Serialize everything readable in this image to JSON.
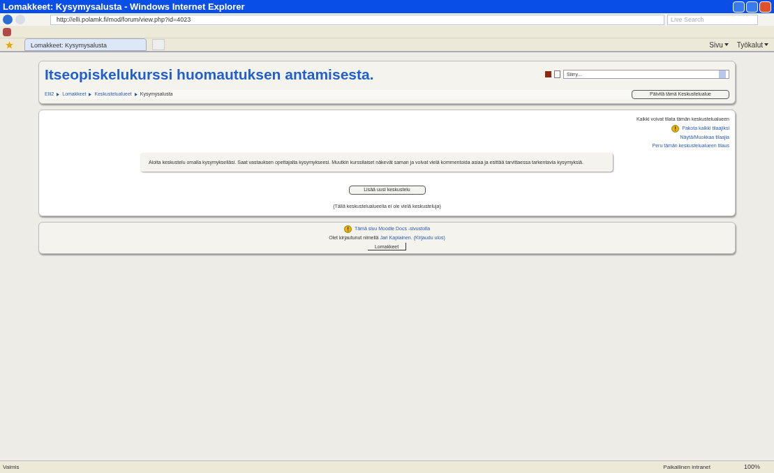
{
  "window": {
    "title": "Lomakkeet: Kysymysalusta - Windows Internet Explorer"
  },
  "address_bar": {
    "url": "http://elli.polamk.fi/mod/forum/view.php?id=4023"
  },
  "search": {
    "placeholder": "Live Search"
  },
  "tabs": [
    {
      "label": "Lomakkeet: Kysymysalusta",
      "selected": true
    }
  ],
  "command_bar": [
    "Sivu",
    "Työkalut"
  ],
  "header": {
    "title": "Itseopiskelukurssi huomautuksen antamisesta.",
    "jump_select": "Siirry...",
    "breadcrumb": [
      "Elli2",
      "Lomakkeet",
      "Keskustelualueet",
      "Kysymysalusta"
    ],
    "update_button": "Päivitä tämä Keskustelualue"
  },
  "subscription": {
    "note": "Kaikki voivat tilata tämän keskustelualueen",
    "links": [
      {
        "label": "Pakota kaikki tilaajiksi",
        "kind": "warning"
      },
      {
        "label": "Näytä/Muokkaa tilaajia",
        "kind": "plain"
      },
      {
        "label": "Peru tämän keskustelualueen tilaus",
        "kind": "plain"
      }
    ]
  },
  "intro": "Aloita keskustelu omalla kysymykselläsi. Saat vastauksen opettajalta kysymykseesi. Muutkin kurssilaiset näkevät saman ja voivat vielä kommentoida asiaa ja esittää tarvittaessa tarkentavia kysymyksiä.",
  "add_button": "Lisää uusi keskustelu",
  "empty_note": "(Tällä keskustelualueella ei ole vielä keskusteluja)",
  "footer": {
    "docs_link": "Tämä sivu Moodle Docs -sivustolla",
    "login_prefix": "Olet kirjautunut nimellä",
    "user_link": "Jari Kapiainen.",
    "logout_link": "(Kirjaudu ulos)",
    "course_button": "Lomakkeet"
  },
  "status_bar": {
    "text": "Valmis",
    "zone": "Paikallinen intranet",
    "zoom": "100%"
  }
}
